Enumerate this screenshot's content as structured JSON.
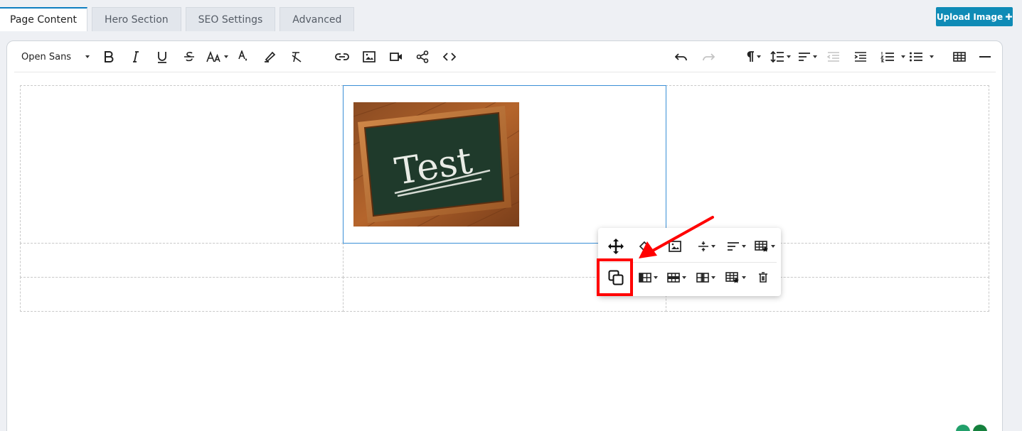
{
  "tabs": [
    {
      "label": "Page Content",
      "active": true
    },
    {
      "label": "Hero Section",
      "active": false
    },
    {
      "label": "SEO Settings",
      "active": false
    },
    {
      "label": "Advanced",
      "active": false
    }
  ],
  "upload_button": {
    "label": "Upload Image",
    "icon": "plus-icon"
  },
  "toolbar": {
    "font_family": "Open Sans",
    "buttons": [
      "bold-icon",
      "italic-icon",
      "underline-icon",
      "strikethrough-icon",
      "font-size-icon",
      "text-color-icon",
      "background-color-icon",
      "clear-formatting-icon",
      "link-icon",
      "image-icon",
      "video-icon",
      "share-icon",
      "code-view-icon",
      "undo-icon",
      "redo-icon",
      "paragraph-format-icon",
      "line-height-icon",
      "align-icon",
      "outdent-icon",
      "indent-icon",
      "ordered-list-icon",
      "unordered-list-icon",
      "table-icon",
      "horizontal-line-icon"
    ]
  },
  "content": {
    "image_text": "Test"
  },
  "table_popup": {
    "row1": [
      "move-icon",
      "cell-background-icon",
      "image-icon",
      "vertical-align-icon",
      "horizontal-align-icon",
      "table-style-icon"
    ],
    "row2": [
      "copy-icon",
      "table-header-icon",
      "row-icon",
      "column-icon",
      "cell-style-icon",
      "delete-icon"
    ]
  },
  "colors": {
    "accent": "#0f8bb6",
    "tab_active_border": "#0f7fc1",
    "highlight": "#ff0000",
    "selection": "#3a8fd6"
  }
}
